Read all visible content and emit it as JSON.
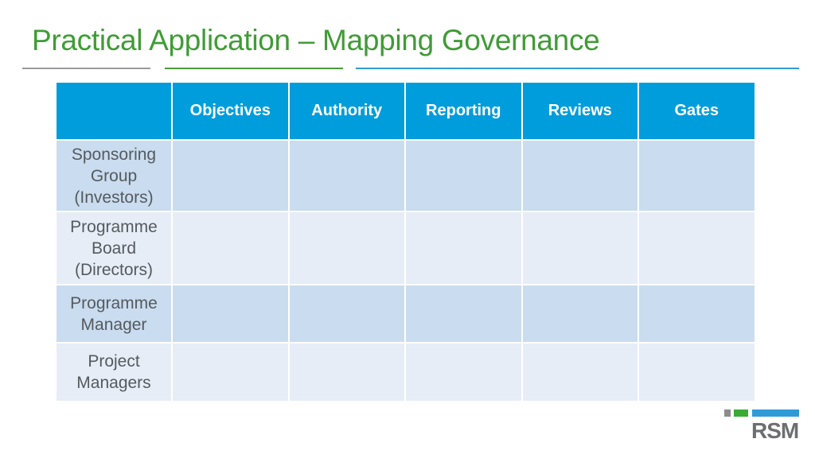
{
  "slide": {
    "title": "Practical Application – Mapping Governance"
  },
  "table": {
    "corner": "",
    "columns": [
      "Objectives",
      "Authority",
      "Reporting",
      "Reviews",
      "Gates"
    ],
    "rows": [
      {
        "label": "Sponsoring Group (Investors)",
        "lines": [
          "Sponsoring",
          "Group",
          "(Investors)"
        ],
        "cells": [
          "",
          "",
          "",
          "",
          ""
        ]
      },
      {
        "label": "Programme Board (Directors)",
        "lines": [
          "Programme",
          "Board",
          "(Directors)"
        ],
        "cells": [
          "",
          "",
          "",
          "",
          ""
        ]
      },
      {
        "label": "Programme Manager",
        "lines": [
          "Programme",
          "Manager"
        ],
        "cells": [
          "",
          "",
          "",
          "",
          ""
        ]
      },
      {
        "label": "Project Managers",
        "lines": [
          "Project",
          "Managers"
        ],
        "cells": [
          "",
          "",
          "",
          "",
          ""
        ]
      }
    ]
  },
  "branding": {
    "logo_text": "RSM",
    "colors": {
      "title_green": "#3f9c35",
      "header_blue": "#009ddc",
      "row_dark": "#cadcef",
      "row_light": "#e6edf7",
      "logo_gray": "#6d6e70",
      "logo_green": "#3aaa35",
      "logo_blue": "#2f9bd6"
    }
  }
}
